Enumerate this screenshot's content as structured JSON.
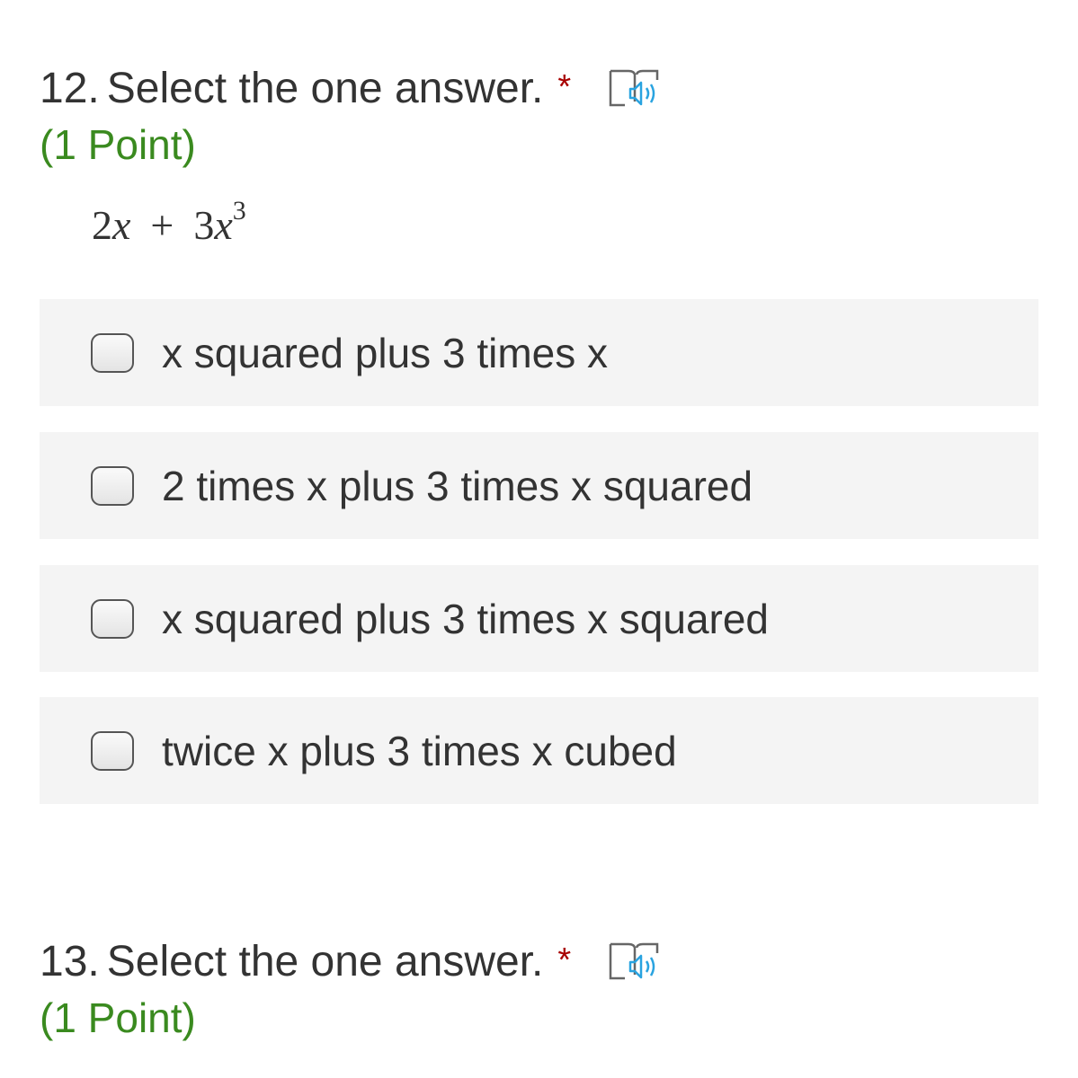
{
  "questions": [
    {
      "number": "12.",
      "text": "Select the one answer.",
      "required_marker": "*",
      "points": "(1 Point)",
      "reader_icon": "immersive-reader-icon",
      "expression": {
        "term1_coef": "2",
        "term1_var": "x",
        "operator": "+",
        "term2_coef": "3",
        "term2_var": "x",
        "term2_exp": "3"
      },
      "options": [
        "x squared plus 3 times x",
        "2 times x plus 3 times x squared",
        "x squared plus 3 times x squared",
        "twice x plus 3 times x cubed"
      ]
    },
    {
      "number": "13.",
      "text": "Select the one answer.",
      "required_marker": "*",
      "points": "(1 Point)",
      "reader_icon": "immersive-reader-icon"
    }
  ],
  "colors": {
    "text": "#333333",
    "required": "#a80000",
    "points": "#3a8a1f",
    "option_bg": "#f4f4f4",
    "reader_icon": "#29a3e0"
  }
}
